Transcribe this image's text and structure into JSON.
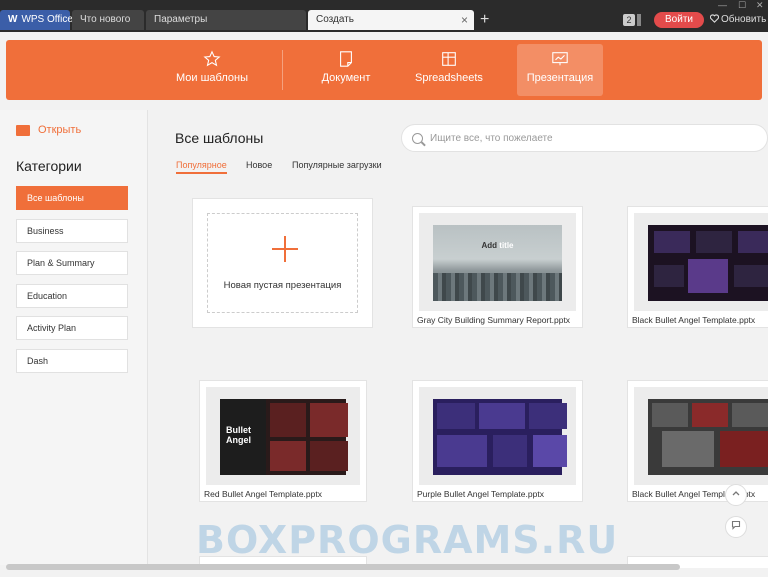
{
  "titlebar": {
    "tabs": [
      {
        "label": "WPS Office"
      },
      {
        "label": "Что нового"
      },
      {
        "label": "Параметры"
      },
      {
        "label": "Создать"
      }
    ],
    "close_glyph": "×",
    "add_glyph": "+",
    "badge_count": "2",
    "login_label": "Войти",
    "update_label": "Обновить"
  },
  "header": {
    "tabs": [
      {
        "label": "Мои шаблоны",
        "icon": "star-icon"
      },
      {
        "label": "Документ",
        "icon": "document-icon"
      },
      {
        "label": "Spreadsheets",
        "icon": "spreadsheet-icon"
      },
      {
        "label": "Презентация",
        "icon": "presentation-icon"
      }
    ],
    "active_index": 3,
    "accent": "#f06f3a"
  },
  "sidebar": {
    "open_label": "Открыть",
    "categories_title": "Категории",
    "items": [
      {
        "label": "Все шаблоны"
      },
      {
        "label": "Business"
      },
      {
        "label": "Plan & Summary"
      },
      {
        "label": "Education"
      },
      {
        "label": "Activity Plan"
      },
      {
        "label": "Dash"
      }
    ],
    "active_index": 0
  },
  "main": {
    "title": "Все шаблоны",
    "search_placeholder": "Ищите все, что пожелаете",
    "filters": [
      {
        "label": "Популярное"
      },
      {
        "label": "Новое"
      },
      {
        "label": "Популярные загрузки"
      }
    ],
    "active_filter": 0,
    "blank_label": "Новая пустая презентация",
    "cards": [
      {
        "label": "Gray City Building Summary Report.pptx",
        "thumb_title_a": "Add",
        "thumb_title_b": "title"
      },
      {
        "label": "Black Bullet Angel Template.pptx"
      },
      {
        "label": "Red Bullet Angel Template.pptx",
        "thumb_text_a": "Bullet",
        "thumb_text_b": "Angel"
      },
      {
        "label": "Purple Bullet Angel Template.pptx"
      },
      {
        "label": "Black Bullet Angel Template.pptx"
      }
    ]
  },
  "watermark": "BOXPROGRAMS.RU"
}
